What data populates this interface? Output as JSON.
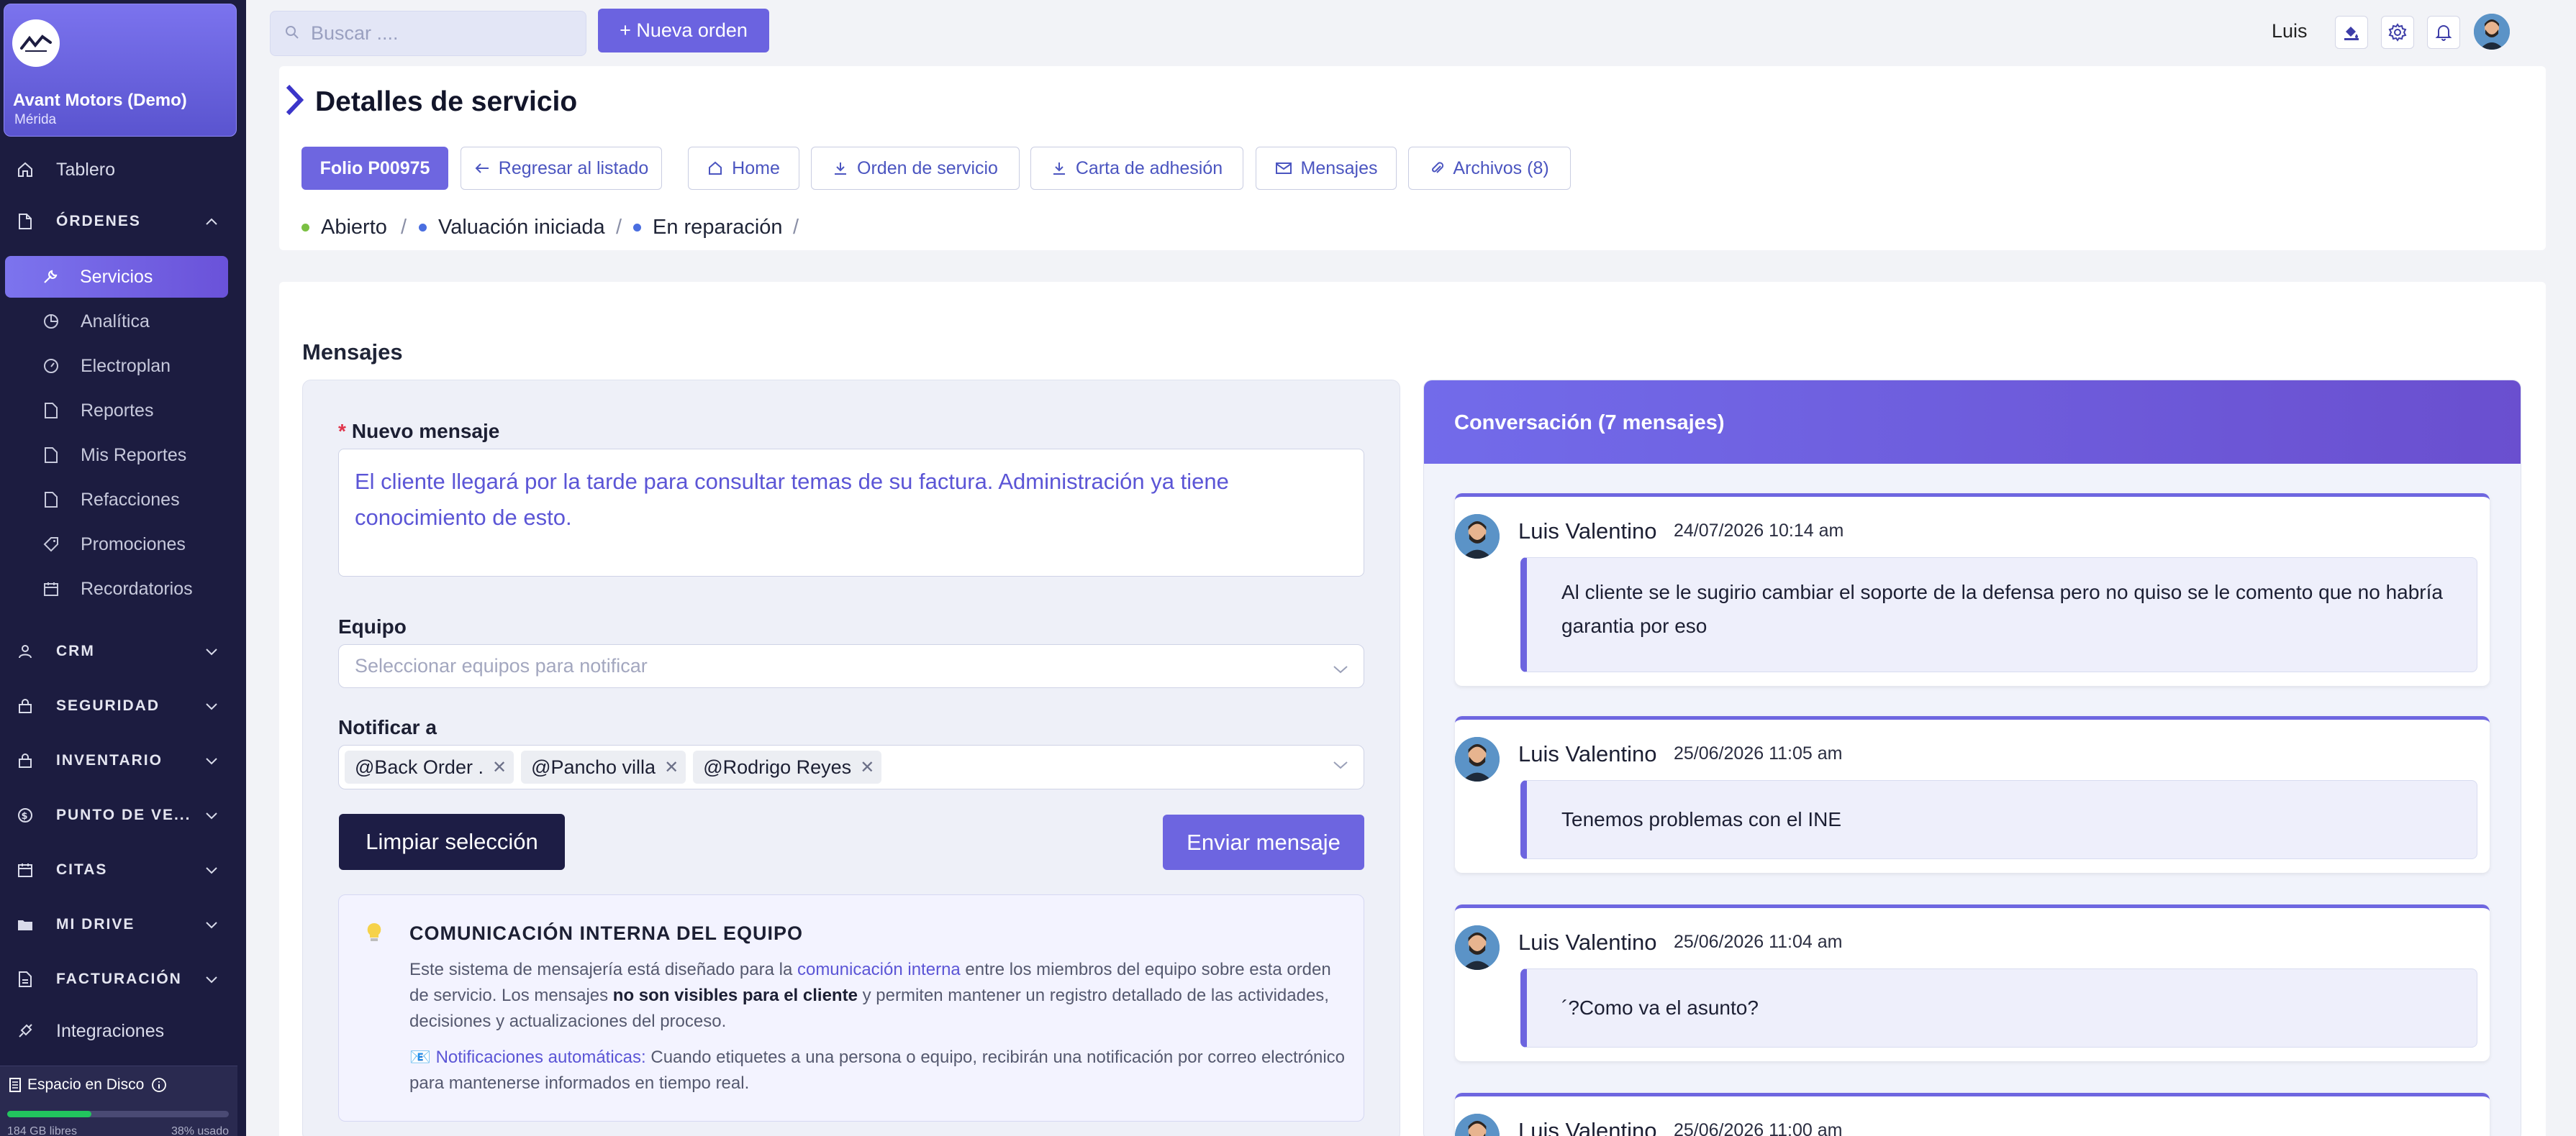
{
  "brand": {
    "name": "Avant Motors (Demo)",
    "city": "Mérida"
  },
  "sidebar": {
    "tablero": "Tablero",
    "ordenes": "ÓRDENES",
    "subitems": [
      "Servicios",
      "Analítica",
      "Electroplan",
      "Reportes",
      "Mis Reportes",
      "Refacciones",
      "Promociones",
      "Recordatorios"
    ],
    "sections": [
      "CRM",
      "SEGURIDAD",
      "INVENTARIO",
      "PUNTO DE VE...",
      "CITAS",
      "MI DRIVE",
      "FACTURACIÓN"
    ],
    "integraciones": "Integraciones",
    "disk": {
      "label": "Espacio en Disco",
      "free": "184 GB libres",
      "used": "38% usado",
      "used_fraction": 0.38
    }
  },
  "topbar": {
    "search_placeholder": "Buscar ....",
    "new_order": "+ Nueva orden",
    "user": "Luis"
  },
  "header": {
    "title": "Detalles de servicio",
    "buttons": [
      "Folio P00975",
      "Regresar al listado",
      "Home",
      "Orden de servicio",
      "Carta de adhesión",
      "Mensajes",
      "Archivos (8)"
    ],
    "statuses": [
      "Abierto",
      "Valuación iniciada",
      "En reparación"
    ],
    "status_colors": [
      "#7bc043",
      "#4a6ee0",
      "#4a6ee0"
    ]
  },
  "main": {
    "section_title": "Mensajes",
    "form": {
      "nuevo_label": "Nuevo mensaje",
      "message": "El cliente llegará por la tarde para consultar temas de su factura. Administración ya tiene conocimiento de esto.",
      "equipo_label": "Equipo",
      "equipo_placeholder": "Seleccionar equipos para notificar",
      "notificar_label": "Notificar a",
      "tags": [
        "@Back Order .",
        "@Pancho villa",
        "@Rodrigo Reyes"
      ],
      "clear": "Limpiar selección",
      "send": "Enviar mensaje"
    },
    "info": {
      "title": "COMUNICACIÓN INTERNA DEL EQUIPO",
      "p1a": "Este sistema de mensajería está diseñado para la ",
      "p1b": "comunicación interna",
      "p1c": " entre los miembros del equipo sobre esta orden de servicio. Los mensajes ",
      "p1d": "no son visibles para el cliente",
      "p1e": " y permiten mantener un registro detallado de las actividades, decisiones y actualizaciones del proceso.",
      "p2a": "Notificaciones automáticas:",
      "p2b": " Cuando etiquetes a una persona o equipo, recibirán una notificación por correo electrónico para mantenerse informados en tiempo real."
    },
    "conversation": {
      "title": "Conversación (7 mensajes)",
      "messages": [
        {
          "name": "Luis Valentino",
          "date": "24/07/2026 10:14 am",
          "text": "Al cliente se le sugirio cambiar el soporte de la defensa pero no quiso se le comento que no habría garantia por eso"
        },
        {
          "name": "Luis Valentino",
          "date": "25/06/2026 11:05 am",
          "text": "Tenemos problemas con el INE"
        },
        {
          "name": "Luis Valentino",
          "date": "25/06/2026 11:04 am",
          "text": "´?Como va el asunto?"
        },
        {
          "name": "Luis Valentino",
          "date": "25/06/2026 11:00 am",
          "text": ""
        }
      ]
    }
  },
  "colors": {
    "accent": "#6b63e0",
    "sidebar": "#1c1c40",
    "dark_button": "#1d1d45"
  }
}
